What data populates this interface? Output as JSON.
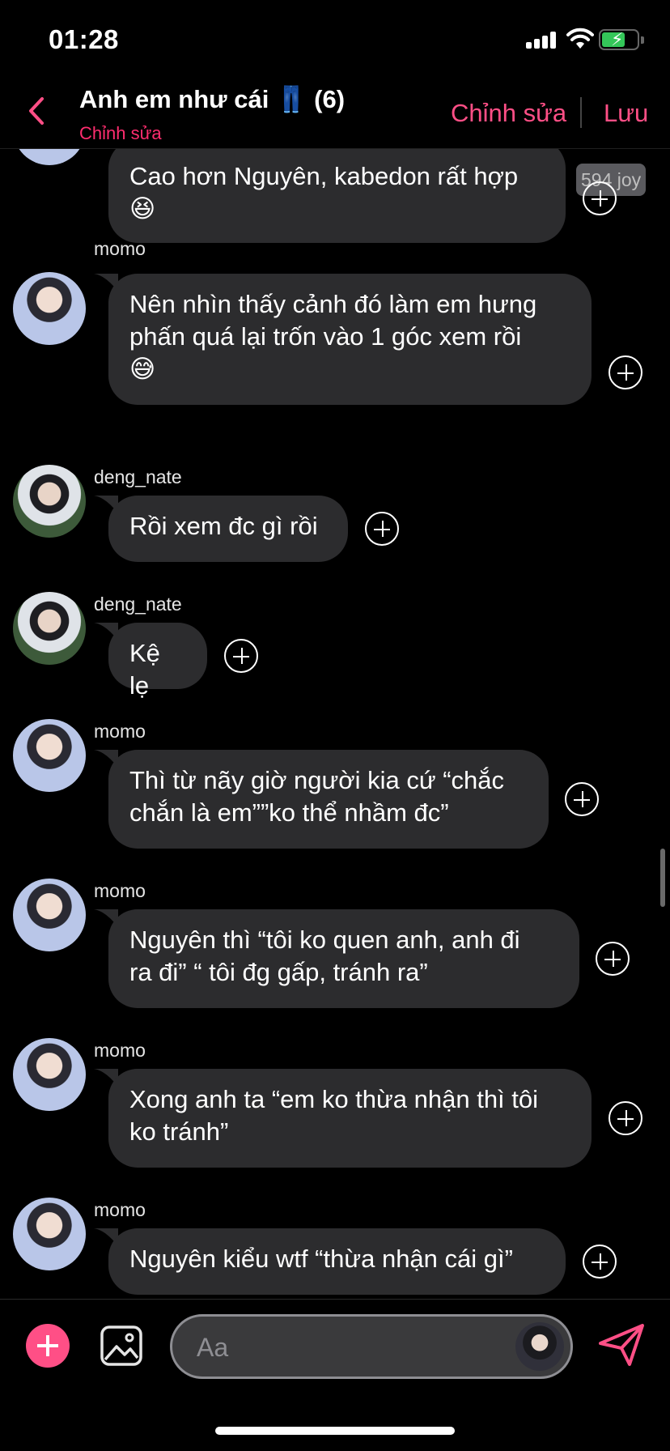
{
  "status_bar": {
    "time": "01:28"
  },
  "header": {
    "title": "Anh em như cái 👖 (6)",
    "subtitle": "Chỉnh sửa",
    "edit_label": "Chỉnh sửa",
    "save_label": "Lưu"
  },
  "messages": [
    {
      "user": "",
      "text": "Cao hơn Nguyên, kabedon rất hợp\n😆",
      "badge": "594 joy"
    },
    {
      "user": "momo",
      "text": "Nên nhìn thấy cảnh đó làm em hưng\nphấn quá lại trốn vào 1 góc xem rồi\n😅"
    },
    {
      "user": "deng_nate",
      "text": "Rồi xem đc gì rồi"
    },
    {
      "user": "deng_nate",
      "text": "Kệ lẹ"
    },
    {
      "user": "momo",
      "text": "Thì từ nãy giờ người kia cứ “chắc\nchắn là em””ko thể nhầm đc”"
    },
    {
      "user": "momo",
      "text": "Nguyên thì “tôi ko quen anh, anh đi\nra đi” “ tôi đg gấp, tránh ra”"
    },
    {
      "user": "momo",
      "text": "Xong anh ta “em ko thừa nhận thì tôi\nko tránh”"
    },
    {
      "user": "momo",
      "text": "Nguyên kiểu wtf “thừa nhận cái gì”"
    }
  ],
  "composer": {
    "placeholder": "Aa"
  },
  "icons": {
    "back": "chevron-left-icon",
    "add": "plus-circle-icon",
    "image": "image-icon",
    "send": "send-icon"
  },
  "colors": {
    "accent": "#ff4f86",
    "bubble": "#2c2c2e",
    "background": "#000000"
  }
}
